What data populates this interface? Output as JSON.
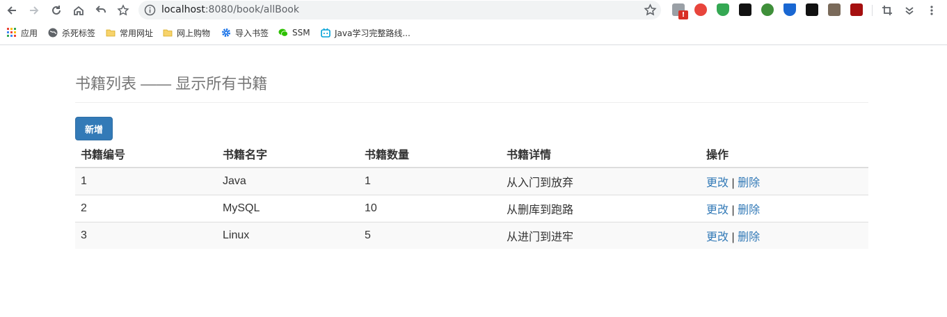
{
  "browser": {
    "url_host": "localhost",
    "url_port": ":8080",
    "url_path": "/book/allBook",
    "extension_badge": "!",
    "bookmarks": [
      {
        "label": "应用",
        "icon": "apps-grid-icon"
      },
      {
        "label": "杀死标签",
        "icon": "globe-icon"
      },
      {
        "label": "常用网址",
        "icon": "folder-icon"
      },
      {
        "label": "网上购物",
        "icon": "folder-icon"
      },
      {
        "label": "导入书签",
        "icon": "gear-icon"
      },
      {
        "label": "SSM",
        "icon": "wechat-icon"
      },
      {
        "label": "Java学习完整路线...",
        "icon": "bilibili-icon"
      }
    ],
    "colors": {
      "folder": "#f7d36b",
      "gear": "#1a73e8",
      "wechat": "#2dc100",
      "bilibili": "#00a1d6"
    }
  },
  "page": {
    "title": "书籍列表 —— 显示所有书籍",
    "add_button": "新增",
    "table": {
      "headers": [
        "书籍编号",
        "书籍名字",
        "书籍数量",
        "书籍详情",
        "操作"
      ],
      "rows": [
        {
          "id": "1",
          "name": "Java",
          "count": "1",
          "detail": "从入门到放弃",
          "edit": "更改",
          "sep": "|",
          "delete": "删除"
        },
        {
          "id": "2",
          "name": "MySQL",
          "count": "10",
          "detail": "从删库到跑路",
          "edit": "更改",
          "sep": "|",
          "delete": "删除"
        },
        {
          "id": "3",
          "name": "Linux",
          "count": "5",
          "detail": "从进门到进牢",
          "edit": "更改",
          "sep": "|",
          "delete": "删除"
        }
      ]
    },
    "colors": {
      "primary": "#337ab7",
      "title_gray": "#777777"
    }
  }
}
